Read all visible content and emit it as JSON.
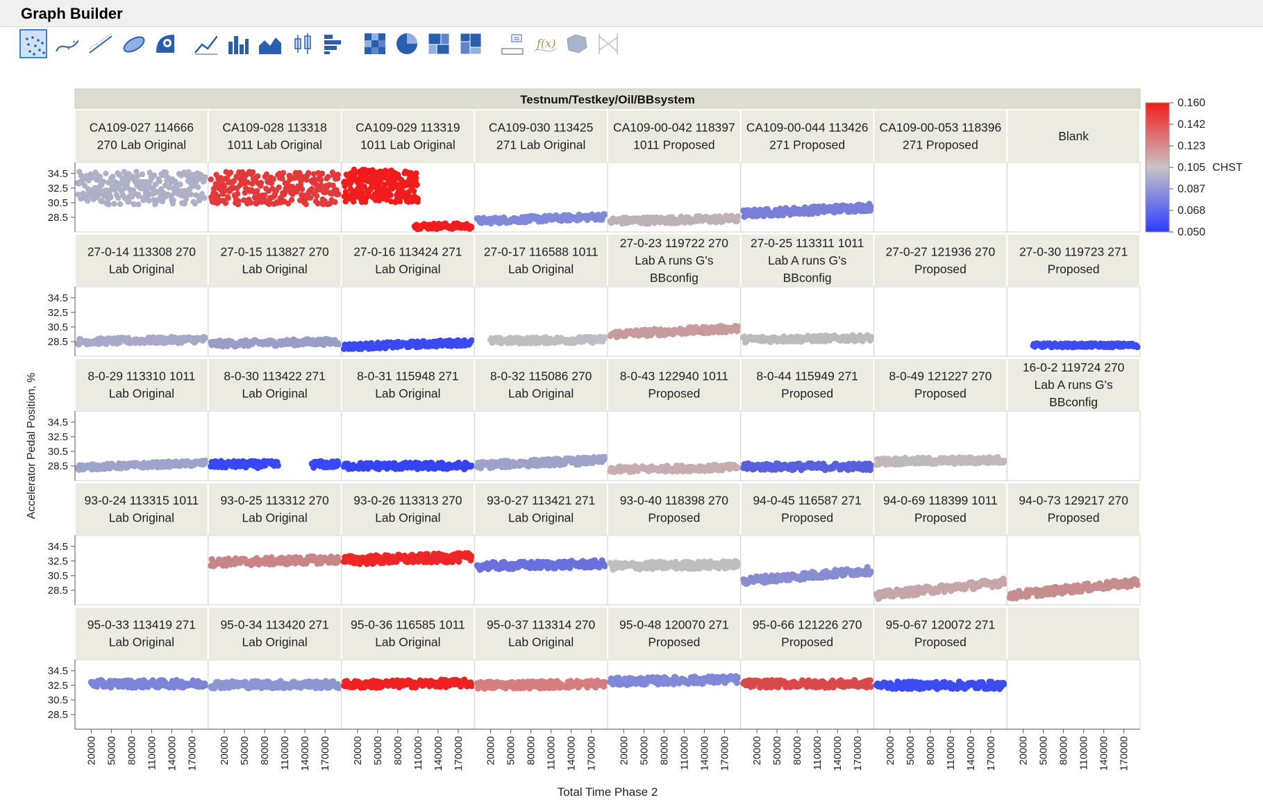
{
  "window": {
    "title": "Graph Builder"
  },
  "toolbar": {
    "buttons": [
      {
        "name": "points-icon",
        "selected": true
      },
      {
        "name": "smoother-icon"
      },
      {
        "name": "line-of-fit-icon"
      },
      {
        "name": "ellipse-icon"
      },
      {
        "name": "contour-icon"
      },
      {
        "name": "line-icon"
      },
      {
        "name": "bar-icon"
      },
      {
        "name": "area-icon"
      },
      {
        "name": "box-plot-icon"
      },
      {
        "name": "histogram-icon"
      },
      {
        "name": "heatmap-icon"
      },
      {
        "name": "pie-icon"
      },
      {
        "name": "treemap-icon"
      },
      {
        "name": "mosaic-icon"
      },
      {
        "name": "caption-box-icon"
      },
      {
        "name": "formula-icon"
      },
      {
        "name": "map-shapes-icon"
      },
      {
        "name": "parallel-icon"
      }
    ]
  },
  "chart_data": {
    "type": "scatter",
    "group_title": "Testnum/Testkey/Oil/BBsystem",
    "xlabel": "Total Time Phase 2",
    "ylabel": "Accelerator Pedal Position, %",
    "x_ticks": [
      "20000",
      "50000",
      "80000",
      "110000",
      "140000",
      "170000"
    ],
    "y_ticks": [
      "34.5",
      "32.5",
      "30.5",
      "28.5"
    ],
    "xlim": [
      0,
      190000
    ],
    "ylim": [
      26.5,
      36
    ],
    "legend": {
      "title": "CHST",
      "position": "right",
      "values": [
        "0.160",
        "0.142",
        "0.123",
        "0.105",
        "0.087",
        "0.068",
        "0.050"
      ],
      "colors": [
        "#f21c1c",
        "#c9c3c8",
        "#2a3cff"
      ]
    },
    "panels": [
      {
        "label": [
          "CA109-027 114666",
          "270 Lab Original"
        ],
        "color": "#aeb0c8",
        "y": 32.5,
        "slope": 0,
        "band": 4.5,
        "x0": 0,
        "x1": 190000,
        "dense": true
      },
      {
        "label": [
          "CA109-028 113318",
          "1011 Lab Original"
        ],
        "color": "#e23a3a",
        "y": 32.5,
        "slope": 0,
        "band": 4.5,
        "x0": 0,
        "x1": 190000,
        "dense": true
      },
      {
        "label": [
          "CA109-029 113319",
          "1011 Lab Original"
        ],
        "color": "#f21c1c",
        "y": 32.8,
        "slope": 0,
        "band": 4.5,
        "x0": 0,
        "x1": 110000,
        "dense": true,
        "tail": {
          "x0": 105000,
          "x1": 190000,
          "y": 27.3
        }
      },
      {
        "label": [
          "CA109-030 113425",
          "271 Lab Original"
        ],
        "color": "#8088d8",
        "y": 28.0,
        "slope": 0.6,
        "band": 0.8,
        "x0": 0,
        "x1": 190000
      },
      {
        "label": [
          "CA109-00-042 118397",
          "1011 Proposed"
        ],
        "color": "#beb2b6",
        "y": 28.0,
        "slope": 0.3,
        "band": 0.9,
        "x0": 0,
        "x1": 190000
      },
      {
        "label": [
          "CA109-00-044 113426",
          "271 Proposed"
        ],
        "color": "#7a7ed6",
        "y": 29.0,
        "slope": 0.9,
        "band": 1.0,
        "x0": 0,
        "x1": 190000
      },
      {
        "label": [
          "CA109-00-053 118396",
          "271 Proposed"
        ],
        "color": "",
        "y": null
      },
      {
        "label": [
          "Blank",
          ""
        ],
        "color": "",
        "y": null
      },
      {
        "label": [
          "27-0-14 113308 270",
          "Lab Original"
        ],
        "color": "#a8a8c8",
        "y": 28.5,
        "slope": 0.3,
        "band": 0.8,
        "x0": 0,
        "x1": 190000
      },
      {
        "label": [
          "27-0-15 113827 270",
          "Lab Original"
        ],
        "color": "#9a9ec6",
        "y": 28.2,
        "slope": 0.3,
        "band": 0.8,
        "x0": 0,
        "x1": 190000
      },
      {
        "label": [
          "27-0-16 113424 271",
          "Lab Original"
        ],
        "color": "#3a4af0",
        "y": 27.8,
        "slope": 0.6,
        "band": 0.8,
        "x0": 0,
        "x1": 190000
      },
      {
        "label": [
          "27-0-17 116588 1011",
          "Lab Original"
        ],
        "color": "#c0bcc4",
        "y": 28.6,
        "slope": 0.2,
        "band": 0.8,
        "x0": 20000,
        "x1": 190000
      },
      {
        "label": [
          "27-0-23 119722 270",
          "Lab A runs G's",
          "BBconfig"
        ],
        "color": "#c79a9c",
        "y": 29.5,
        "slope": 0.8,
        "band": 0.9,
        "x0": 0,
        "x1": 190000
      },
      {
        "label": [
          "27-0-25 113311 1011",
          "Lab A runs G's",
          "BBconfig"
        ],
        "color": "#bdbabd",
        "y": 28.8,
        "slope": 0.2,
        "band": 0.8,
        "x0": 0,
        "x1": 190000
      },
      {
        "label": [
          "27-0-27 121936 270",
          "Proposed"
        ],
        "color": "",
        "y": null
      },
      {
        "label": [
          "27-0-30 119723 271",
          "Proposed"
        ],
        "color": "#3c4cf2",
        "y": 28.0,
        "slope": 0,
        "band": 0.5,
        "x0": 35000,
        "x1": 190000
      },
      {
        "label": [
          "8-0-29 113310 1011",
          "Lab Original"
        ],
        "color": "#9da4cc",
        "y": 28.3,
        "slope": 0.6,
        "band": 0.7,
        "x0": 0,
        "x1": 190000
      },
      {
        "label": [
          "8-0-30 113422 271",
          "Lab Original"
        ],
        "color": "#3848f4",
        "y": 28.7,
        "slope": 0,
        "band": 0.9,
        "x0": 0,
        "x1": 190000,
        "gap": [
          100000,
          150000
        ]
      },
      {
        "label": [
          "8-0-31 115948 271",
          "Lab Original"
        ],
        "color": "#3444f2",
        "y": 28.5,
        "slope": 0,
        "band": 0.9,
        "x0": 0,
        "x1": 190000
      },
      {
        "label": [
          "8-0-32 115086 270",
          "Lab Original"
        ],
        "color": "#9ea2c8",
        "y": 28.6,
        "slope": 0.7,
        "band": 0.9,
        "x0": 0,
        "x1": 190000
      },
      {
        "label": [
          "8-0-43 122940 1011",
          "Proposed"
        ],
        "color": "#c6aeb0",
        "y": 28.0,
        "slope": 0.3,
        "band": 0.8,
        "x0": 0,
        "x1": 190000
      },
      {
        "label": [
          "8-0-44 115949 271",
          "Proposed"
        ],
        "color": "#5860e0",
        "y": 28.4,
        "slope": 0,
        "band": 0.9,
        "x0": 0,
        "x1": 190000
      },
      {
        "label": [
          "8-0-49 121227 270",
          "Proposed"
        ],
        "color": "#bfb8bc",
        "y": 29.1,
        "slope": 0.2,
        "band": 0.9,
        "x0": 0,
        "x1": 190000
      },
      {
        "label": [
          "16-0-2 119724 270",
          "Lab A runs G's",
          "BBconfig"
        ],
        "color": "",
        "y": null
      },
      {
        "label": [
          "93-0-24 113315 1011",
          "Lab Original"
        ],
        "color": "",
        "y": null
      },
      {
        "label": [
          "93-0-25 113312 270",
          "Lab Original"
        ],
        "color": "#c98486",
        "y": 32.3,
        "slope": 0.4,
        "band": 1.0,
        "x0": 0,
        "x1": 190000
      },
      {
        "label": [
          "93-0-26 113313 270",
          "Lab Original"
        ],
        "color": "#ee2626",
        "y": 32.6,
        "slope": 0.4,
        "band": 1.2,
        "x0": 0,
        "x1": 190000
      },
      {
        "label": [
          "93-0-27 113421 271",
          "Lab Original"
        ],
        "color": "#6a70dc",
        "y": 31.8,
        "slope": 0.3,
        "band": 1.0,
        "x0": 0,
        "x1": 190000
      },
      {
        "label": [
          "93-0-40 118398 270",
          "Proposed"
        ],
        "color": "#c0bcc2",
        "y": 31.8,
        "slope": 0.2,
        "band": 1.0,
        "x0": 0,
        "x1": 190000
      },
      {
        "label": [
          "94-0-45 116587 271",
          "Proposed"
        ],
        "color": "#888cd0",
        "y": 29.8,
        "slope": 1.4,
        "band": 1.0,
        "x0": 0,
        "x1": 190000
      },
      {
        "label": [
          "94-0-69 118399 1011",
          "Proposed"
        ],
        "color": "#c6a6a8",
        "y": 27.8,
        "slope": 1.8,
        "band": 1.0,
        "x0": 0,
        "x1": 190000
      },
      {
        "label": [
          "94-0-73 129217 270",
          "Proposed"
        ],
        "color": "#c78c8e",
        "y": 27.8,
        "slope": 1.8,
        "band": 1.0,
        "x0": 0,
        "x1": 190000
      },
      {
        "label": [
          "95-0-33 113419 271",
          "Lab Original"
        ],
        "color": "#7c84d8",
        "y": 32.7,
        "slope": 0,
        "band": 1.0,
        "x0": 20000,
        "x1": 190000
      },
      {
        "label": [
          "95-0-34 113420 271",
          "Lab Original"
        ],
        "color": "#8e96d2",
        "y": 32.6,
        "slope": 0,
        "band": 1.0,
        "x0": 0,
        "x1": 190000
      },
      {
        "label": [
          "95-0-36 116585 1011",
          "Lab Original"
        ],
        "color": "#ee2222",
        "y": 32.6,
        "slope": 0.2,
        "band": 1.0,
        "x0": 0,
        "x1": 190000
      },
      {
        "label": [
          "95-0-37 113314 270",
          "Lab Original"
        ],
        "color": "#d47e80",
        "y": 32.5,
        "slope": 0.2,
        "band": 1.0,
        "x0": 0,
        "x1": 190000
      },
      {
        "label": [
          "95-0-48 120070 271",
          "Proposed"
        ],
        "color": "#8088d8",
        "y": 33.0,
        "slope": 0.3,
        "band": 1.0,
        "x0": 0,
        "x1": 190000
      },
      {
        "label": [
          "95-0-66 121226 270",
          "Proposed"
        ],
        "color": "#da4a4c",
        "y": 32.7,
        "slope": 0,
        "band": 1.0,
        "x0": 0,
        "x1": 190000
      },
      {
        "label": [
          "95-0-67 120072 271",
          "Proposed"
        ],
        "color": "#3c4cf0",
        "y": 32.5,
        "slope": 0,
        "band": 1.0,
        "x0": 0,
        "x1": 190000
      },
      {
        "label": [
          "",
          ""
        ],
        "color": "",
        "y": null
      }
    ]
  }
}
